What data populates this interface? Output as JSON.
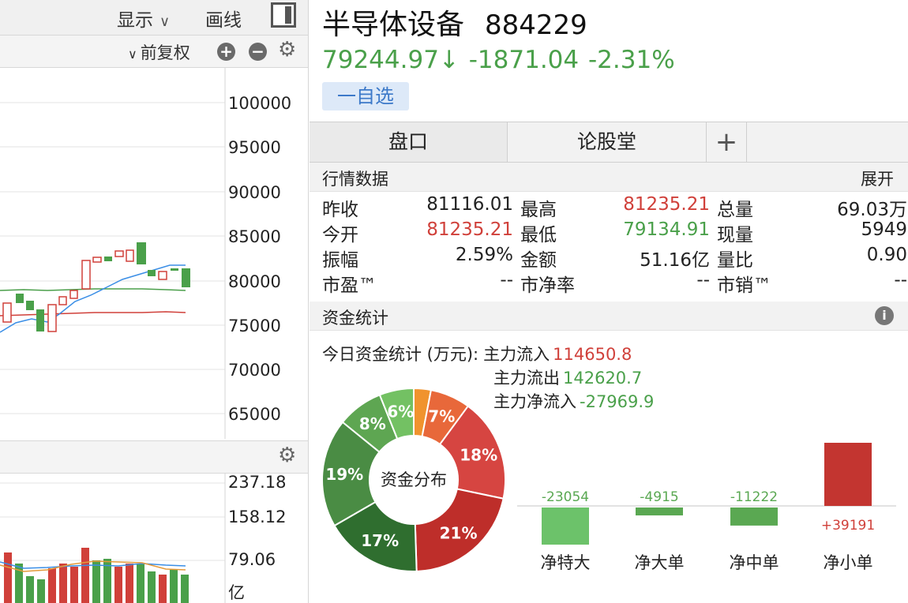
{
  "left_toolbar": {
    "display_label": "显示",
    "draw_label": "画线",
    "adjust_label": "前复权"
  },
  "price_axis": {
    "ticks": [
      "100000",
      "95000",
      "90000",
      "85000",
      "80000",
      "75000",
      "70000",
      "65000"
    ]
  },
  "volume_axis": {
    "ticks": [
      "237.18",
      "158.12",
      "79.06",
      "亿"
    ]
  },
  "stock": {
    "name": "半导体设备",
    "code": "884229",
    "price": "79244.97↓",
    "change": "-1871.04",
    "change_pct": "-2.31%",
    "watch_label": "一自选"
  },
  "tabs": [
    {
      "label": "盘口"
    },
    {
      "label": "论股堂"
    },
    {
      "label": "+"
    }
  ],
  "quote_section": {
    "title": "行情数据",
    "expand_label": "展开",
    "rows": [
      [
        {
          "label": "昨收",
          "value": "81116.01",
          "color": "black"
        },
        {
          "label": "最高",
          "value": "81235.21",
          "color": "red"
        },
        {
          "label": "总量",
          "value": "69.03万",
          "color": "black"
        }
      ],
      [
        {
          "label": "今开",
          "value": "81235.21",
          "color": "red"
        },
        {
          "label": "最低",
          "value": "79134.91",
          "color": "green"
        },
        {
          "label": "现量",
          "value": "5949",
          "color": "black"
        }
      ],
      [
        {
          "label": "振幅",
          "value": "2.59%",
          "color": "black"
        },
        {
          "label": "金额",
          "value": "51.16亿",
          "color": "black"
        },
        {
          "label": "量比",
          "value": "0.90",
          "color": "black"
        }
      ],
      [
        {
          "label": "市盈™",
          "value": "--",
          "color": "black"
        },
        {
          "label": "市净率",
          "value": "--",
          "color": "black"
        },
        {
          "label": "市销™",
          "value": "--",
          "color": "black"
        }
      ]
    ]
  },
  "fund_section": {
    "title": "资金统计",
    "info_icon": "info-icon",
    "today_label": "今日资金统计 (万元):",
    "inflow_label": "主力流入",
    "inflow_value": "114650.8",
    "outflow_label": "主力流出",
    "outflow_value": "142620.7",
    "net_label": "主力净流入",
    "net_value": "-27969.9",
    "donut_center": "资金分布"
  },
  "chart_data": [
    {
      "type": "pie",
      "title": "资金分布",
      "slices": [
        {
          "label": "3%",
          "value": 3,
          "color": "#f0932e",
          "show_label": false
        },
        {
          "label": "7%",
          "value": 7,
          "color": "#e8683a",
          "show_label": true
        },
        {
          "label": "18%",
          "value": 18,
          "color": "#d64541",
          "show_label": true
        },
        {
          "label": "21%",
          "value": 21,
          "color": "#be2e2a",
          "show_label": true
        },
        {
          "label": "17%",
          "value": 17,
          "color": "#2f6e2f",
          "show_label": true
        },
        {
          "label": "19%",
          "value": 19,
          "color": "#4a8c44",
          "show_label": true
        },
        {
          "label": "8%",
          "value": 8,
          "color": "#5ea652",
          "show_label": true
        },
        {
          "label": "6%",
          "value": 6,
          "color": "#73c163",
          "show_label": true
        }
      ]
    },
    {
      "type": "bar",
      "categories": [
        "净特大",
        "净大单",
        "净中单",
        "净小单"
      ],
      "values": [
        -23054,
        -4915,
        -11222,
        39191
      ],
      "labels": [
        "-23054",
        "-4915",
        "-11222",
        "+39191"
      ],
      "colors": [
        "#6cc26a",
        "#5aa852",
        "#5aa852",
        "#c33530"
      ]
    }
  ]
}
